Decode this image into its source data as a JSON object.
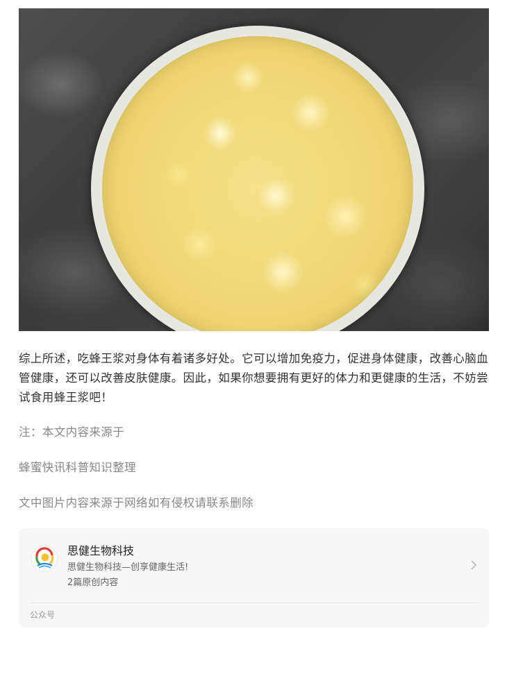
{
  "article": {
    "summary": "综上所述，吃蜂王浆对身体有着诸多好处。它可以增加免疫力，促进身体健康，改善心脑血管健康，还可以改善皮肤健康。因此，如果你想要拥有更好的体力和更健康的生活，不妨尝试食用蜂王浆吧！",
    "note_source": "注：本文内容来源于",
    "note_org": "蜂蜜快讯科普知识整理",
    "note_images": "文中图片内容来源于网络如有侵权请联系删除"
  },
  "profile_card": {
    "name": "思健生物科技",
    "description": "思健生物科技—创享健康生活!",
    "original_count": "2篇原创内容",
    "account_type": "公众号",
    "avatar_icon": "sijian-logo-icon",
    "chevron_icon": "chevron-right-icon"
  }
}
